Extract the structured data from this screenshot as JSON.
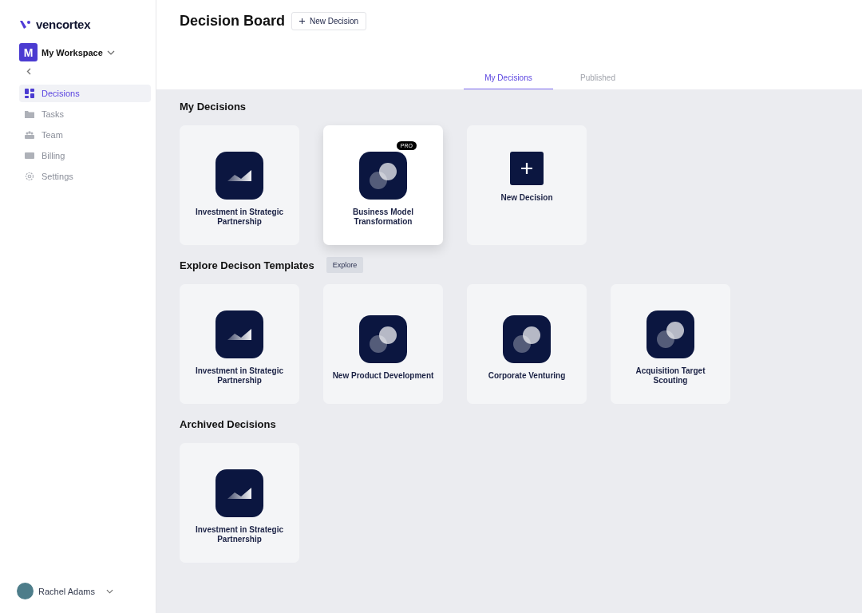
{
  "sidebar": {
    "brand": "vencortex",
    "workspace": {
      "initial": "M",
      "name": "My Workspace"
    },
    "items": [
      {
        "label": "Decisions",
        "kind": "grid",
        "selected": true
      },
      {
        "label": "Tasks",
        "kind": "folder",
        "selected": false
      },
      {
        "label": "Team",
        "kind": "team",
        "selected": false
      },
      {
        "label": "Billing",
        "kind": "card",
        "selected": false
      },
      {
        "label": "Settings",
        "kind": "gear",
        "selected": false
      }
    ],
    "user": {
      "name": "Rachel Adams"
    }
  },
  "header": {
    "title": "Decision Board",
    "new_button": "New Decision"
  },
  "tabs": [
    {
      "label": "My Decisions",
      "selected": true
    },
    {
      "label": "Published",
      "selected": false
    }
  ],
  "sections": [
    {
      "title": "My Decisions",
      "cards": [
        {
          "kind": "chart",
          "label": "Investment in Strategic Partnership",
          "highlighted": false
        },
        {
          "kind": "circles",
          "label": "Business Model Transformation",
          "highlighted": true,
          "badge": "PRO"
        },
        {
          "kind": "add",
          "label": "New Decision",
          "highlighted": false
        }
      ]
    },
    {
      "title": "Explore Decison Templates",
      "action": "Explore",
      "cards": [
        {
          "kind": "chart",
          "label": "Investment in Strategic Partnership",
          "highlighted": false
        },
        {
          "kind": "circles",
          "label": "New Product Development",
          "highlighted": false
        },
        {
          "kind": "circles",
          "label": "Corporate Venturing",
          "highlighted": false
        },
        {
          "kind": "circles",
          "label": "Acquisition Target Scouting",
          "highlighted": false
        }
      ]
    },
    {
      "title": "Archived Decisions",
      "cards": [
        {
          "kind": "chart",
          "label": "Investment in Strategic Partnership",
          "highlighted": false
        }
      ]
    }
  ]
}
